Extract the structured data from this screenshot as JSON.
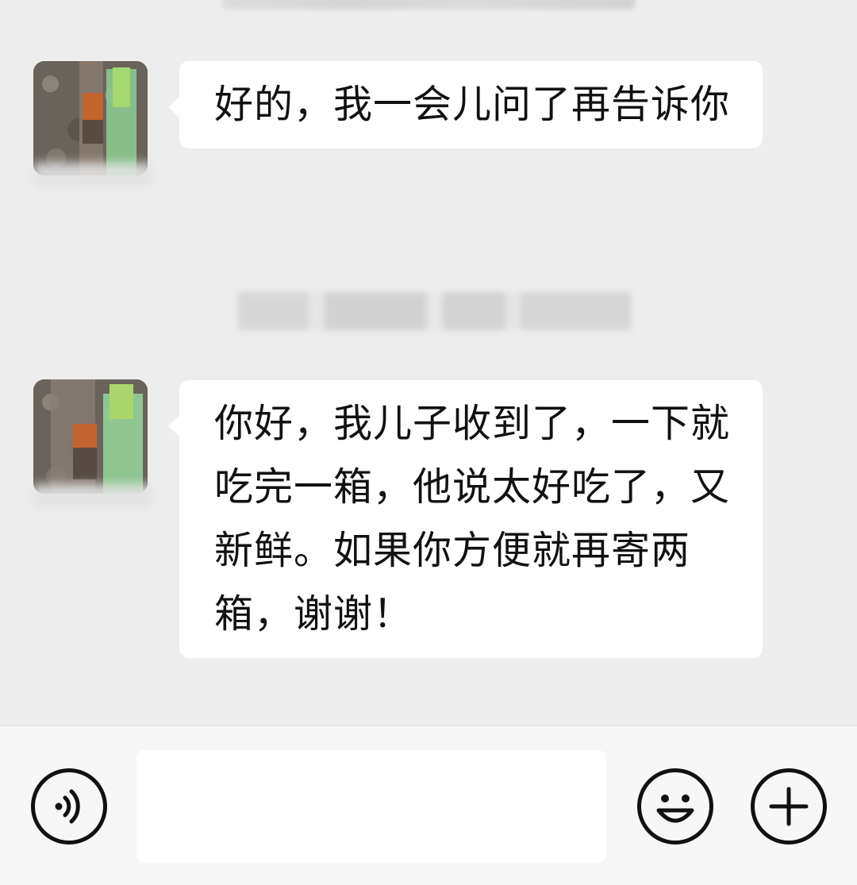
{
  "chat": {
    "messages": [
      {
        "sender": "contact",
        "text": "好的，我一会儿问了再告诉你"
      },
      {
        "sender": "contact",
        "text": "你好，我儿子收到了，一下就吃完一箱，他说太好吃了，又新鲜。如果你方便就再寄两箱，谢谢！"
      }
    ]
  },
  "input_bar": {
    "voice_icon": "voice-icon",
    "emoji_icon": "emoji-icon",
    "more_icon": "plus-icon",
    "message_value": ""
  },
  "colors": {
    "chat_background": "#ededed",
    "bubble": "#ffffff",
    "input_bar": "#f7f7f7"
  }
}
